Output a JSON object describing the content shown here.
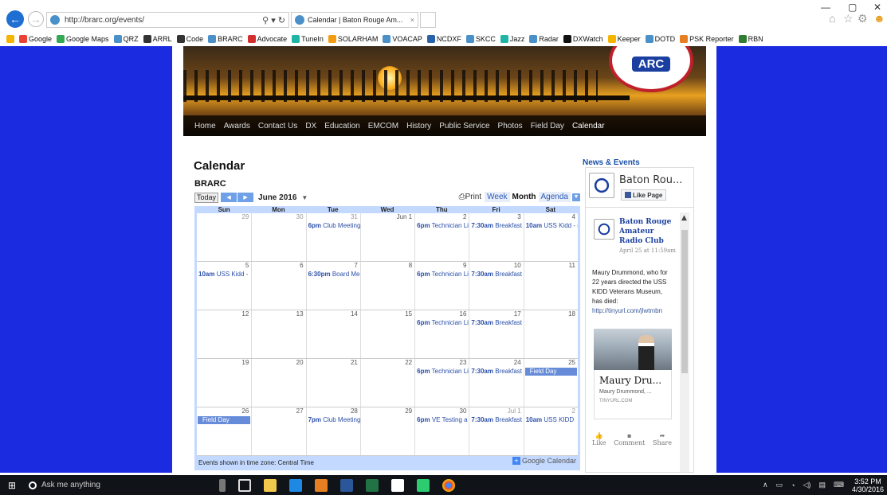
{
  "browser": {
    "url": "http://brarc.org/events/",
    "tab_title": "Calendar | Baton Rouge Am...",
    "favorites": [
      "Google",
      "Google Maps",
      "QRZ",
      "ARRL",
      "Code",
      "BRARC",
      "Advocate",
      "TuneIn",
      "SOLARHAM",
      "VOACAP",
      "NCDXF",
      "SKCC",
      "Jazz",
      "Radar",
      "DXWatch",
      "Keeper",
      "DOTD",
      "PSK Reporter",
      "RBN"
    ]
  },
  "site": {
    "logo_text": "ARC",
    "nav": [
      "Home",
      "Awards",
      "Contact Us",
      "DX",
      "Education",
      "EMCOM",
      "History",
      "Public Service",
      "Photos",
      "Field Day",
      "Calendar"
    ]
  },
  "page_title": "Calendar",
  "calendar": {
    "name": "BRARC",
    "today_label": "Today",
    "month_label": "June 2016",
    "print_label": "Print",
    "views": [
      "Week",
      "Month",
      "Agenda"
    ],
    "days_of_week": [
      "Sun",
      "Mon",
      "Tue",
      "Wed",
      "Thu",
      "Fri",
      "Sat"
    ],
    "weeks": [
      [
        {
          "n": "29",
          "other": true
        },
        {
          "n": "30",
          "other": true
        },
        {
          "n": "31",
          "other": true,
          "time": "6pm",
          "title": "Club Meeting"
        },
        {
          "n": "Jun 1"
        },
        {
          "n": "2",
          "time": "6pm",
          "title": "Technician Li"
        },
        {
          "n": "3",
          "time": "7:30am",
          "title": "Breakfast"
        },
        {
          "n": "4",
          "time": "10am",
          "title": "USS Kidd - ("
        }
      ],
      [
        {
          "n": "5",
          "time": "10am",
          "title": "USS Kidd -"
        },
        {
          "n": "6"
        },
        {
          "n": "7",
          "time": "6:30pm",
          "title": "Board Mee"
        },
        {
          "n": "8"
        },
        {
          "n": "9",
          "time": "6pm",
          "title": "Technician Li"
        },
        {
          "n": "10",
          "time": "7:30am",
          "title": "Breakfast"
        },
        {
          "n": "11"
        }
      ],
      [
        {
          "n": "12"
        },
        {
          "n": "13"
        },
        {
          "n": "14"
        },
        {
          "n": "15"
        },
        {
          "n": "16",
          "time": "6pm",
          "title": "Technician Li"
        },
        {
          "n": "17",
          "time": "7:30am",
          "title": "Breakfast"
        },
        {
          "n": "18"
        }
      ],
      [
        {
          "n": "19"
        },
        {
          "n": "20"
        },
        {
          "n": "21"
        },
        {
          "n": "22"
        },
        {
          "n": "23",
          "time": "6pm",
          "title": "Technician Li"
        },
        {
          "n": "24",
          "time": "7:30am",
          "title": "Breakfast"
        },
        {
          "n": "25",
          "allday": "Field Day"
        }
      ],
      [
        {
          "n": "26",
          "allday": "Field Day"
        },
        {
          "n": "27"
        },
        {
          "n": "28",
          "time": "7pm",
          "title": "Club Meeting"
        },
        {
          "n": "29"
        },
        {
          "n": "30",
          "time": "6pm",
          "title": "VE Testing a"
        },
        {
          "n": "Jul 1",
          "other": true,
          "time": "7:30am",
          "title": "Breakfast"
        },
        {
          "n": "2",
          "other": true,
          "time": "10am",
          "title": "USS KIDD"
        }
      ]
    ],
    "timezone_note": "Events shown in time zone: Central Time",
    "google_calendar_label": "Google Calendar"
  },
  "sidebar": {
    "heading": "News & Events",
    "page_name": "Baton Rou...",
    "like_label": "Like Page",
    "post": {
      "author": "Baton Rouge Amateur Radio Club",
      "date": "April 25 at 11:59am",
      "text": "Maury Drummond, who for 22 years directed the USS KIDD Veterans Museum, has died: ",
      "link": "http://tinyurl.com/jlwtmbn",
      "card_title": "Maury Dru...",
      "card_desc": "Maury Drummond, ...",
      "card_domain": "TINYURL.COM",
      "actions": [
        "Like",
        "Comment",
        "Share"
      ]
    }
  },
  "taskbar": {
    "search_placeholder": "Ask me anything",
    "time": "3:52 PM",
    "date": "4/30/2016"
  }
}
